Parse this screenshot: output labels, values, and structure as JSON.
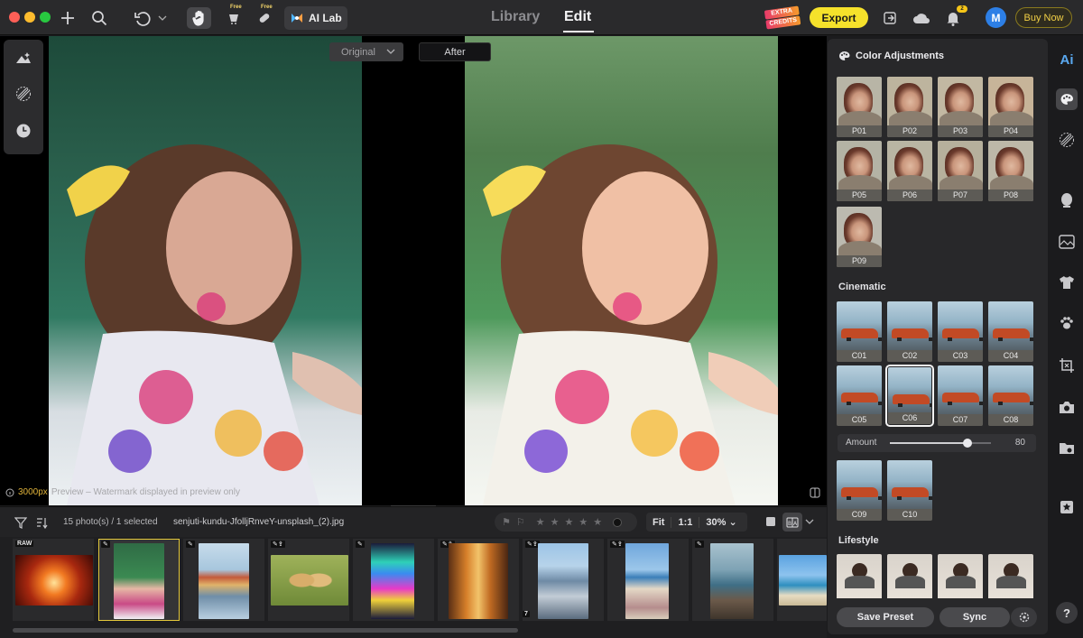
{
  "topbar": {
    "ailab_label": "AI Lab",
    "free_tag": "Free",
    "nav_tabs": [
      "Library",
      "Edit"
    ],
    "active_tab": "Edit",
    "extra_credits": [
      "EXTRA",
      "CREDITS"
    ],
    "export_label": "Export",
    "notification_count": "2",
    "avatar_initial": "M",
    "buy_now_label": "Buy Now"
  },
  "canvas": {
    "original_label": "Original",
    "after_label": "After",
    "preview_size": "3000px",
    "preview_note": "Preview – Watermark displayed in preview only"
  },
  "filmstrip": {
    "count_text": "15 photo(s) / 1 selected",
    "filename": "senjuti-kundu-JfolljRnveY-unsplash_(2).jpg",
    "fit_label": "Fit",
    "one_to_one": "1:1",
    "zoom": "30%",
    "raw_badge": "RAW",
    "stack_count": "7",
    "thumbs": [
      {
        "name": "tunnel-light",
        "badge": "RAW"
      },
      {
        "name": "painted-child",
        "badge": "edit"
      },
      {
        "name": "waterfront-town",
        "badge": "edit"
      },
      {
        "name": "two-puppies",
        "badge": "edit-export"
      },
      {
        "name": "neon-tower",
        "badge": "edit"
      },
      {
        "name": "narrow-street",
        "badge": "edit-export"
      },
      {
        "name": "city-skyline",
        "badge": "edit-export"
      },
      {
        "name": "beach-crowd",
        "badge": "edit-export"
      },
      {
        "name": "rocky-shore",
        "badge": "edit"
      },
      {
        "name": "tropical-beach",
        "badge": "none"
      }
    ]
  },
  "panel": {
    "title": "Color Adjustments",
    "portrait_presets": [
      "P01",
      "P02",
      "P03",
      "P04",
      "P05",
      "P06",
      "P07",
      "P08",
      "P09"
    ],
    "cinematic_title": "Cinematic",
    "cinematic_presets_a": [
      "C01",
      "C02",
      "C03",
      "C04",
      "C05",
      "C06",
      "C07",
      "C08"
    ],
    "cinematic_presets_b": [
      "C09",
      "C10"
    ],
    "selected_preset": "C06",
    "amount_label": "Amount",
    "amount_value": "80",
    "lifestyle_title": "Lifestyle",
    "save_preset_label": "Save Preset",
    "sync_label": "Sync"
  },
  "rail": {
    "ai_label": "Ai",
    "help_label": "?"
  },
  "colors": {
    "accent_yellow": "#f5e12b",
    "avatar_blue": "#2d7fe6",
    "panel_bg": "#28282a"
  }
}
